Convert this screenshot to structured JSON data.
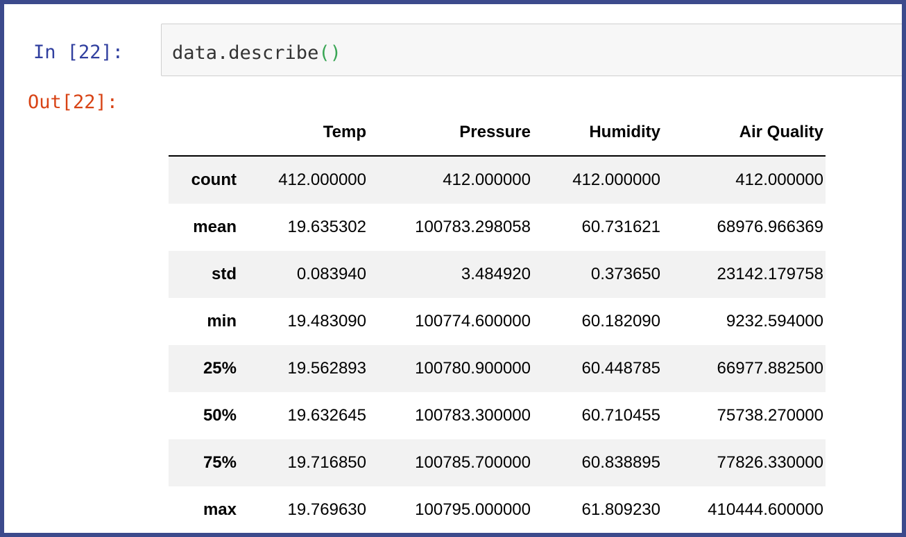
{
  "input_cell": {
    "prompt": "In [22]:",
    "code_prefix": "data.describe",
    "code_parens": "()"
  },
  "output_cell": {
    "prompt": "Out[22]:"
  },
  "table": {
    "columns": [
      "",
      "Temp",
      "Pressure",
      "Humidity",
      "Air Quality"
    ],
    "rows": [
      {
        "label": "count",
        "values": [
          "412.000000",
          "412.000000",
          "412.000000",
          "412.000000"
        ]
      },
      {
        "label": "mean",
        "values": [
          "19.635302",
          "100783.298058",
          "60.731621",
          "68976.966369"
        ]
      },
      {
        "label": "std",
        "values": [
          "0.083940",
          "3.484920",
          "0.373650",
          "23142.179758"
        ]
      },
      {
        "label": "min",
        "values": [
          "19.483090",
          "100774.600000",
          "60.182090",
          "9232.594000"
        ]
      },
      {
        "label": "25%",
        "values": [
          "19.562893",
          "100780.900000",
          "60.448785",
          "66977.882500"
        ]
      },
      {
        "label": "50%",
        "values": [
          "19.632645",
          "100783.300000",
          "60.710455",
          "75738.270000"
        ]
      },
      {
        "label": "75%",
        "values": [
          "19.716850",
          "100785.700000",
          "60.838895",
          "77826.330000"
        ]
      },
      {
        "label": "max",
        "values": [
          "19.769630",
          "100795.000000",
          "61.809230",
          "410444.600000"
        ]
      }
    ]
  },
  "colors": {
    "frame_border": "#3c4a8c",
    "in_prompt": "#303f9f",
    "out_prompt": "#d84315",
    "paren": "#3aa655",
    "stripe": "#f2f2f2"
  }
}
